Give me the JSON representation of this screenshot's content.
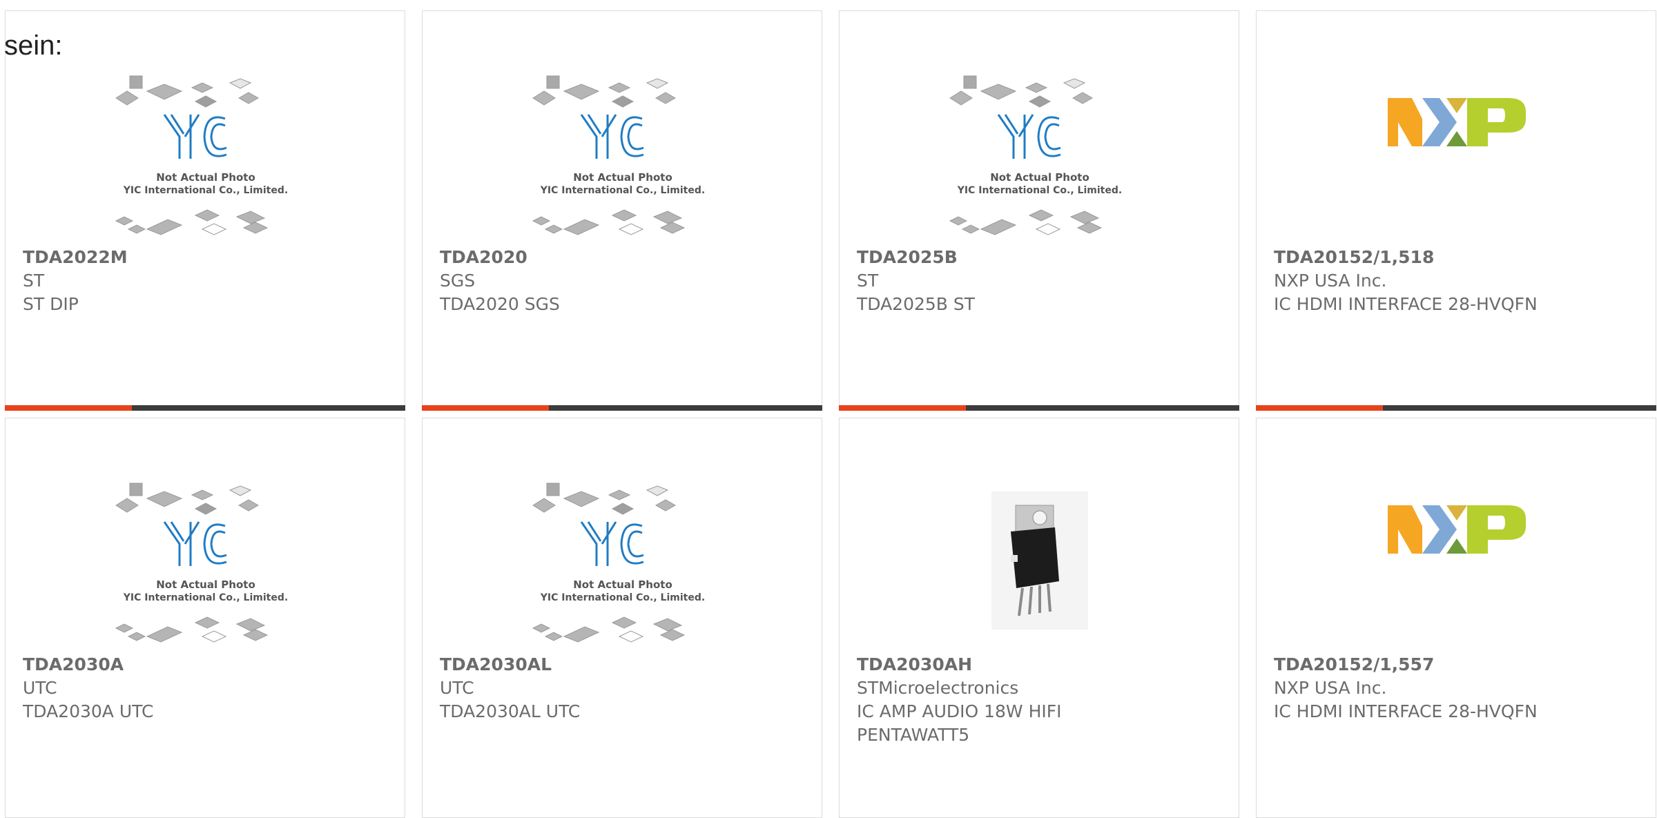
{
  "heading": "sein:",
  "placeholder": {
    "line1": "Not Actual Photo",
    "line2": "YIC International Co., Limited."
  },
  "products": [
    {
      "part": "TDA2022M",
      "maker": "ST",
      "desc": "ST DIP",
      "image": "yic-placeholder"
    },
    {
      "part": "TDA2020",
      "maker": "SGS",
      "desc": "TDA2020 SGS",
      "image": "yic-placeholder"
    },
    {
      "part": "TDA2025B",
      "maker": "ST",
      "desc": "TDA2025B ST",
      "image": "yic-placeholder"
    },
    {
      "part": "TDA20152/1,518",
      "maker": "NXP USA Inc.",
      "desc": "IC HDMI INTERFACE 28-HVQFN",
      "image": "nxp-logo",
      "logo_text": "NXP"
    },
    {
      "part": "TDA2030A",
      "maker": "UTC",
      "desc": "TDA2030A UTC",
      "image": "yic-placeholder"
    },
    {
      "part": "TDA2030AL",
      "maker": "UTC",
      "desc": "TDA2030AL UTC",
      "image": "yic-placeholder"
    },
    {
      "part": "TDA2030AH",
      "maker": "STMicroelectronics",
      "desc": "IC AMP AUDIO 18W HIFI PENTAWATT5",
      "image": "to220-chip-photo"
    },
    {
      "part": "TDA20152/1,557",
      "maker": "NXP USA Inc.",
      "desc": "IC HDMI INTERFACE 28-HVQFN",
      "image": "nxp-logo",
      "logo_text": "NXP"
    }
  ],
  "colors": {
    "accent": "#e8431a",
    "bar_dark": "#3c3c3c",
    "text_gray": "#6b6b6b",
    "yic_blue": "#1f7cc4",
    "nxp_orange": "#f5a623",
    "nxp_blue": "#7fa8d6",
    "nxp_green": "#b5cf2e"
  }
}
